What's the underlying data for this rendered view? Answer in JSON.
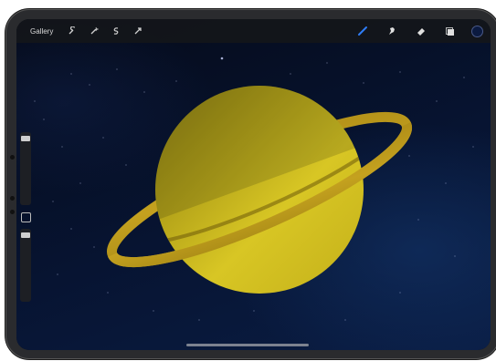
{
  "toolbar": {
    "gallery_label": "Gallery",
    "left_tools": [
      {
        "name": "wrench-icon"
      },
      {
        "name": "magic-wand-icon"
      },
      {
        "name": "selection-icon"
      },
      {
        "name": "transform-arrow-icon"
      }
    ],
    "right_tools": [
      {
        "name": "brush-icon",
        "active": true,
        "color": "#2f7cf6"
      },
      {
        "name": "smudge-icon"
      },
      {
        "name": "eraser-icon"
      },
      {
        "name": "layers-icon"
      }
    ],
    "current_color": "#0b1a40"
  },
  "sidebar": {
    "brush_size_level": 0.95,
    "opacity_level": 0.95
  },
  "artwork": {
    "subject": "planet-with-ring",
    "planet_color": "#c9b51c",
    "ring_color": "#b8961a",
    "background_color": "#071432"
  }
}
